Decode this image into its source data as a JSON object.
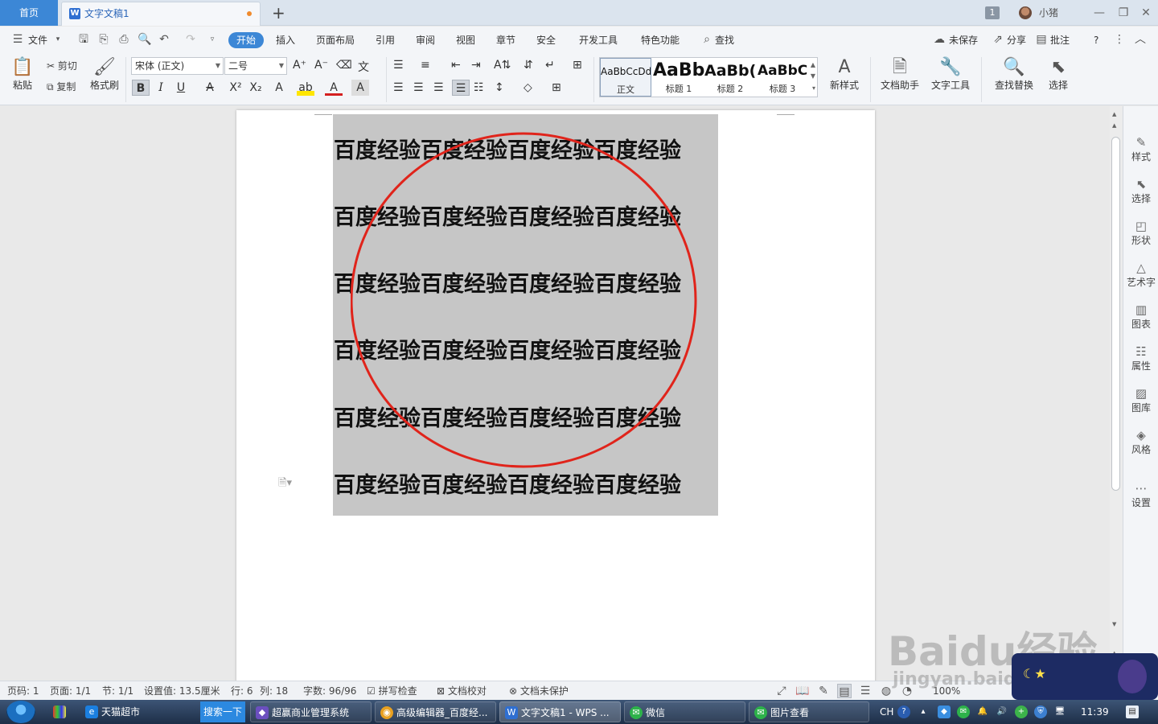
{
  "tabs": {
    "home": "首页",
    "document": "文字文稿1",
    "add": "+",
    "badge": "1",
    "user": "小猪"
  },
  "menu": {
    "file": "文件",
    "items": [
      "开始",
      "插入",
      "页面布局",
      "引用",
      "审阅",
      "视图",
      "章节",
      "安全",
      "开发工具",
      "特色功能"
    ],
    "search": "查找",
    "unsaved": "未保存",
    "share": "分享",
    "comment": "批注",
    "help": "?"
  },
  "ribbon": {
    "paste": "粘贴",
    "cut": "剪切",
    "copy": "复制",
    "format_painter": "格式刷",
    "font_name": "宋体 (正文)",
    "font_size": "二号",
    "styles": [
      {
        "preview": "AaBbCcDd",
        "label": "正文"
      },
      {
        "preview": "AaBb",
        "label": "标题 1"
      },
      {
        "preview": "AaBb(",
        "label": "标题 2"
      },
      {
        "preview": "AaBbC",
        "label": "标题 3"
      }
    ],
    "new_style": "新样式",
    "doc_helper": "文档助手",
    "text_tools": "文字工具",
    "find_replace": "查找替换",
    "select": "选择"
  },
  "document": {
    "lines": [
      "百度经验百度经验百度经验百度经验",
      "百度经验百度经验百度经验百度经验",
      "百度经验百度经验百度经验百度经验",
      "百度经验百度经验百度经验百度经验",
      "百度经验百度经验百度经验百度经验",
      "百度经验百度经验百度经验百度经验"
    ],
    "annotation_color": "#e0241b",
    "selection_color": "#c6c6c6"
  },
  "right_panel": [
    "样式",
    "选择",
    "形状",
    "艺术字",
    "图表",
    "属性",
    "图库",
    "风格",
    "设置"
  ],
  "status": {
    "page_code": "页码: 1",
    "page": "页面: 1/1",
    "section": "节: 1/1",
    "setting": "设置值: 13.5厘米",
    "row": "行: 6",
    "col": "列: 18",
    "word_count": "字数: 96/96",
    "spell_check": "拼写检查",
    "doc_proof": "文档校对",
    "doc_protect": "文档未保护",
    "zoom": "100%"
  },
  "taskbar": {
    "items": [
      {
        "label": "天猫超市",
        "color": "#1b7fe0"
      },
      {
        "label": "搜索一下",
        "color": "#2c89e0"
      },
      {
        "label": "超赢商业管理系统",
        "color": "#6b4fbf"
      },
      {
        "label": "高级编辑器_百度经...",
        "color": "#e8a020"
      },
      {
        "label": "文字文稿1 - WPS ...",
        "color": "#2f6fd1"
      },
      {
        "label": "微信",
        "color": "#2db24a"
      },
      {
        "label": "图片查看",
        "color": "#2db24a"
      }
    ],
    "ime": "CH",
    "time": "11:39"
  },
  "watermark": {
    "brand": "Baidu经验",
    "url": "jingyan.baidu.com"
  }
}
